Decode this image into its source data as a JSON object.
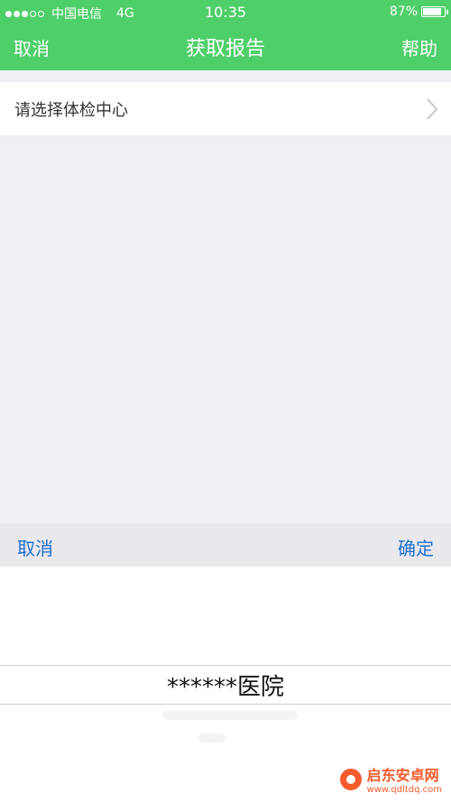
{
  "status_bar": {
    "carrier": "中国电信",
    "network": "4G",
    "time": "10:35",
    "battery": "87%",
    "battery_level": 0.87
  },
  "nav": {
    "left_label": "取消",
    "title": "获取报告",
    "right_label": "帮助"
  },
  "select_row": {
    "label": "请选择体检中心"
  },
  "picker": {
    "cancel_label": "取消",
    "confirm_label": "确定",
    "selected_option": "******医院"
  },
  "watermark": {
    "name": "启东安卓网",
    "url": "www.qdltdq.com"
  },
  "colors": {
    "header": "#4fcf6a",
    "link": "#1f6fd0",
    "background": "#f0eff4"
  }
}
